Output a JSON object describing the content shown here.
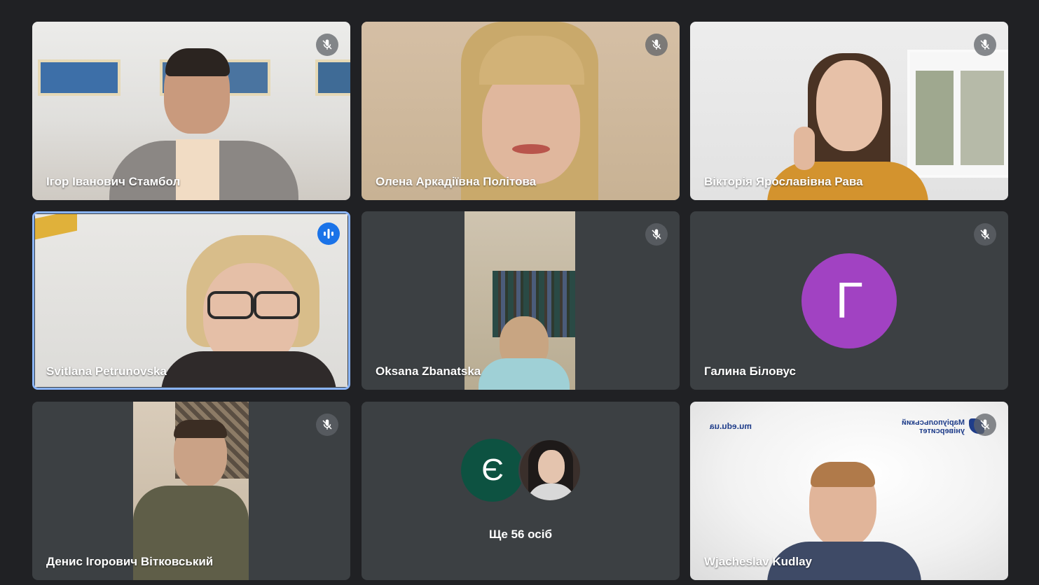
{
  "participants": [
    {
      "name": "Ігор Іванович Стамбол"
    },
    {
      "name": "Олена Аркадіївна Політова"
    },
    {
      "name": "Вікторія Ярославівна Рава"
    },
    {
      "name": "Svitlana Petrunovska"
    },
    {
      "name": "Oksana Zbanatska"
    },
    {
      "name": "Галина Біловус",
      "initial": "Г",
      "avatar_color": "#a142c2"
    },
    {
      "name": "Денис Ігорович Вітковський"
    },
    {
      "name": "Wjacheslav Kudlay"
    }
  ],
  "overflow": {
    "initial": "Є",
    "initial_color": "#0d5241",
    "label": "Ще 56 осіб"
  },
  "background_logo": {
    "site": "mu.edu.ua",
    "university_line1": "Маріупольський",
    "university_line2": "університет"
  },
  "icons": {
    "muted": "mic-off-icon",
    "speaking": "audio-level-icon"
  },
  "colors": {
    "page_bg": "#202124",
    "tile_bg": "#3c4043",
    "active_border": "#8ab4f8",
    "speaking": "#1a73e8"
  }
}
